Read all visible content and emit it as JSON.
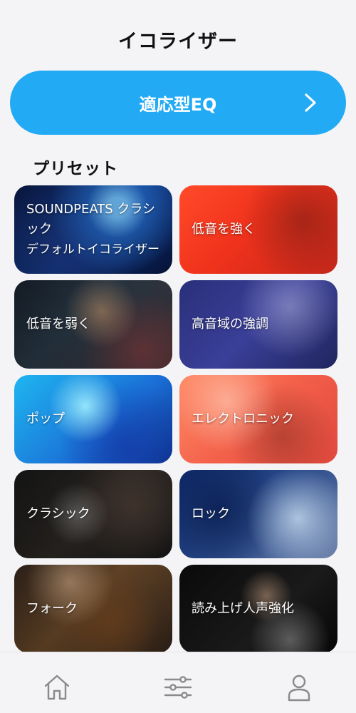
{
  "header": {
    "title": "イコライザー"
  },
  "adaptive_eq": {
    "label": "適応型EQ",
    "icon": "chevron-right-icon"
  },
  "presets": {
    "title": "プリセット",
    "items": [
      {
        "line1": "SOUNDPEATS クラシ",
        "line2": "ック",
        "line3": "デフォルトイコライザー"
      },
      {
        "label": "低音を強く"
      },
      {
        "label": "低音を弱く"
      },
      {
        "label": "高音域の強調"
      },
      {
        "label": "ポップ"
      },
      {
        "label": "エレクトロニック"
      },
      {
        "label": "クラシック"
      },
      {
        "label": "ロック"
      },
      {
        "label": "フォーク"
      },
      {
        "label": "読み上げ人声強化"
      }
    ]
  },
  "tabbar": {
    "items": [
      {
        "icon": "home-icon"
      },
      {
        "icon": "equalizer-sliders-icon"
      },
      {
        "icon": "profile-icon"
      }
    ]
  },
  "colors": {
    "accent": "#22aaf4",
    "background": "#f4f4f6"
  }
}
